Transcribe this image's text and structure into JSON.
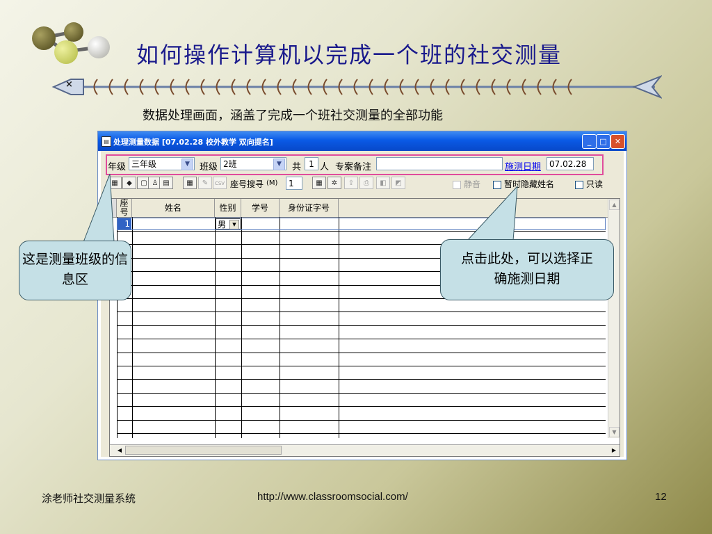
{
  "slide": {
    "title": "如何操作计算机以完成一个班的社交测量",
    "subtitle": "数据处理画面，涵盖了完成一个班社交测量的全部功能",
    "fish_head_mark": "×"
  },
  "window": {
    "title": "处理测量数据 [07.02.28  校外教学  双向提名]",
    "buttons": {
      "minimize": "_",
      "maximize": "□",
      "close": "✕"
    },
    "info": {
      "grade_label": "年级",
      "grade_value": "三年级",
      "class_label": "班级",
      "class_value": "2班",
      "total_label": "共",
      "total_value": "1",
      "people_label": "人",
      "remark_label": "专案备注",
      "remark_value": "",
      "date_link": "施测日期",
      "date_value": "07.02.28"
    },
    "toolbar": {
      "seat_search_label": "座号搜寻",
      "seat_search_shortcut": "(M)",
      "seat_search_value": "1",
      "mute_label": "静音",
      "hide_names_label": "暂时隐藏姓名",
      "readonly_label": "只读",
      "csv_label": "CSV"
    },
    "grid": {
      "columns": [
        "座号",
        "姓名",
        "性别",
        "学号",
        "身份证字号"
      ],
      "rows": [
        {
          "seat": "1",
          "name": "",
          "gender": "男",
          "student_id": "",
          "id_number": ""
        }
      ]
    }
  },
  "callouts": {
    "left": "这是测量班级的信息区",
    "right": "点击此处，可以选择正确施测日期"
  },
  "footer": {
    "left": "涂老师社交测量系统",
    "center": "http://www.classroomsocial.com/",
    "page_number": "12"
  }
}
